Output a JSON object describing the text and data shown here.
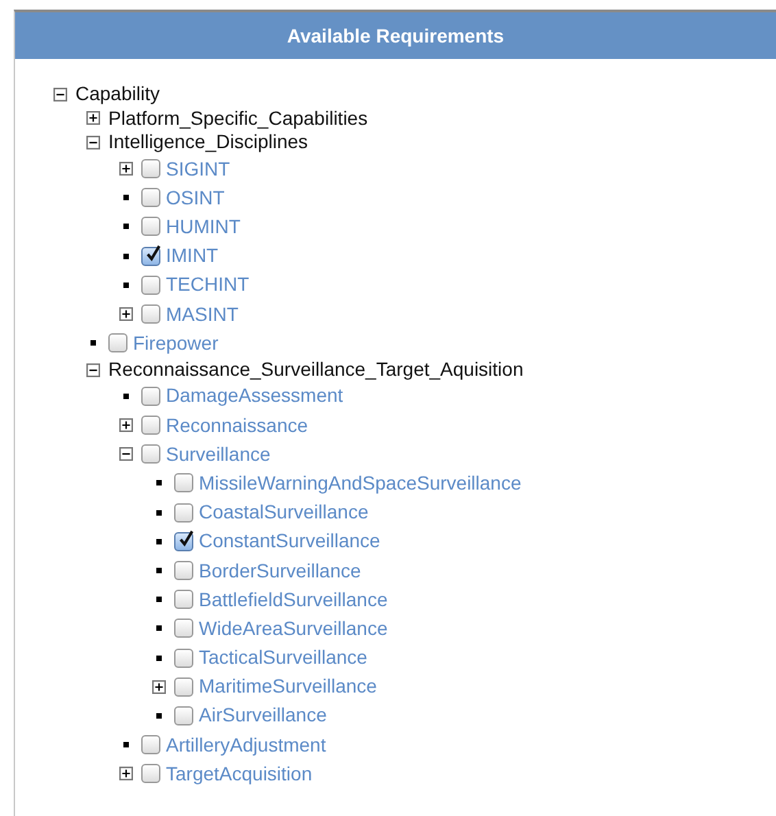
{
  "panel": {
    "title": "Available Requirements"
  },
  "tree": [
    {
      "kind": "group",
      "label": "Capability",
      "expanded": true,
      "children": [
        {
          "kind": "group",
          "label": "Platform_Specific_Capabilities",
          "expanded": false
        },
        {
          "kind": "group",
          "label": "Intelligence_Disciplines",
          "expanded": true,
          "children": [
            {
              "kind": "option",
              "label": "SIGINT",
              "checked": false,
              "expanded": false
            },
            {
              "kind": "option",
              "label": "OSINT",
              "checked": false
            },
            {
              "kind": "option",
              "label": "HUMINT",
              "checked": false
            },
            {
              "kind": "option",
              "label": "IMINT",
              "checked": true
            },
            {
              "kind": "option",
              "label": "TECHINT",
              "checked": false
            },
            {
              "kind": "option",
              "label": "MASINT",
              "checked": false,
              "expanded": false
            }
          ]
        },
        {
          "kind": "option",
          "label": "Firepower",
          "checked": false
        },
        {
          "kind": "group",
          "label": "Reconnaissance_Surveillance_Target_Aquisition",
          "expanded": true,
          "children": [
            {
              "kind": "option",
              "label": "DamageAssessment",
              "checked": false
            },
            {
              "kind": "option",
              "label": "Reconnaissance",
              "checked": false,
              "expanded": false
            },
            {
              "kind": "option",
              "label": "Surveillance",
              "checked": false,
              "expanded": true,
              "children": [
                {
                  "kind": "option",
                  "label": "MissileWarningAndSpaceSurveillance",
                  "checked": false
                },
                {
                  "kind": "option",
                  "label": "CoastalSurveillance",
                  "checked": false
                },
                {
                  "kind": "option",
                  "label": "ConstantSurveillance",
                  "checked": true
                },
                {
                  "kind": "option",
                  "label": "BorderSurveillance",
                  "checked": false
                },
                {
                  "kind": "option",
                  "label": "BattlefieldSurveillance",
                  "checked": false
                },
                {
                  "kind": "option",
                  "label": "WideAreaSurveillance",
                  "checked": false
                },
                {
                  "kind": "option",
                  "label": "TacticalSurveillance",
                  "checked": false
                },
                {
                  "kind": "option",
                  "label": "MaritimeSurveillance",
                  "checked": false,
                  "expanded": false
                },
                {
                  "kind": "option",
                  "label": "AirSurveillance",
                  "checked": false
                }
              ]
            },
            {
              "kind": "option",
              "label": "ArtilleryAdjustment",
              "checked": false
            },
            {
              "kind": "option",
              "label": "TargetAcquisition",
              "checked": false,
              "expanded": false
            }
          ]
        }
      ]
    }
  ]
}
